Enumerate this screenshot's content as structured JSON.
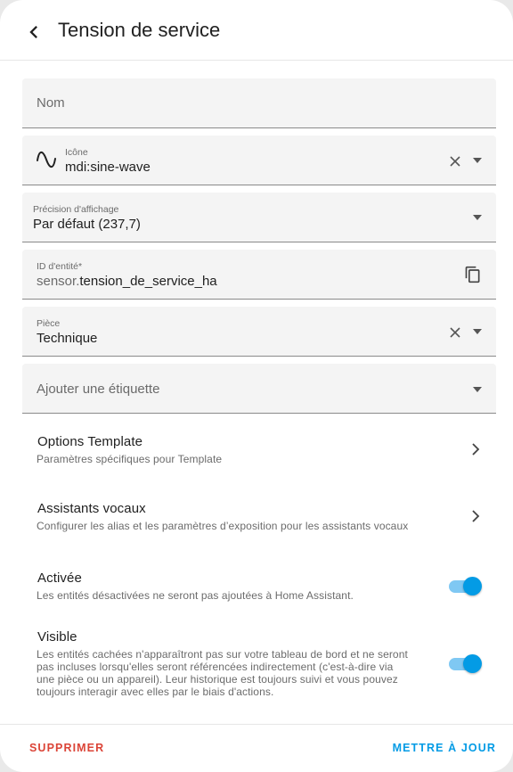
{
  "header": {
    "title": "Tension de service",
    "back_icon": "chevron-left-icon"
  },
  "fields": {
    "name": {
      "label": "Nom"
    },
    "icon": {
      "label": "Icône",
      "value": "mdi:sine-wave",
      "icon": "sine-wave-icon"
    },
    "precision": {
      "label": "Précision d'affichage",
      "value": "Par défaut (237,7)"
    },
    "entity_id": {
      "label": "ID d'entité*",
      "prefix": "sensor.",
      "value": "tension_de_service_ha"
    },
    "area": {
      "label": "Pièce",
      "value": "Technique"
    },
    "labels": {
      "label": "Ajouter une étiquette"
    }
  },
  "rows": {
    "template": {
      "title": "Options Template",
      "subtitle": "Paramètres spécifiques pour Template"
    },
    "voice": {
      "title": "Assistants vocaux",
      "subtitle": "Configurer les alias et les paramètres d’exposition pour les assistants vocaux"
    },
    "enabled": {
      "title": "Activée",
      "subtitle": "Les entités désactivées ne seront pas ajoutées à Home Assistant.",
      "on": true
    },
    "visible": {
      "title": "Visible",
      "subtitle_lines": [
        "Les entités cachées n'apparaîtront pas sur votre tableau de bord et ne seront",
        "pas incluses lorsqu'elles seront référencées indirectement (c'est-à-dire via",
        "une pièce ou un appareil). Leur historique est toujours suivi et vous pouvez",
        "toujours interagir avec elles par le biais d'actions."
      ],
      "on": true
    }
  },
  "footer": {
    "delete_label": "SUPPRIMER",
    "update_label": "METTRE À JOUR"
  },
  "colors": {
    "accent": "#039be5",
    "danger": "#db4437"
  }
}
